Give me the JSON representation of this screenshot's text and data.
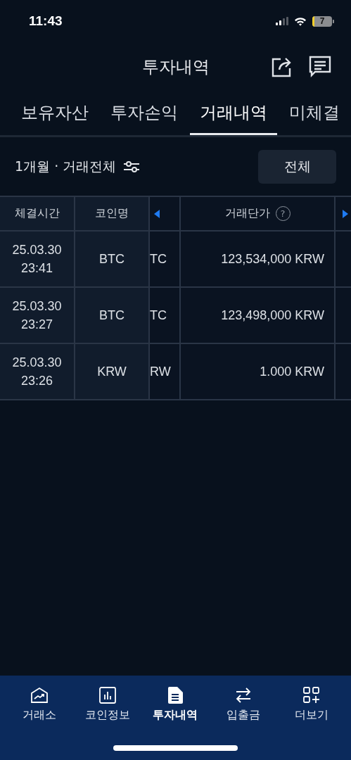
{
  "status_bar": {
    "time": "11:43",
    "battery": "7"
  },
  "header": {
    "title": "투자내역"
  },
  "tabs": [
    {
      "label": "보유자산",
      "selected": false
    },
    {
      "label": "투자손익",
      "selected": false
    },
    {
      "label": "거래내역",
      "selected": true
    },
    {
      "label": "미체결",
      "selected": false
    }
  ],
  "filter": {
    "label": "1개월 · 거래전체",
    "button": "전체"
  },
  "table": {
    "columns": [
      {
        "kind": "text",
        "label": "체결시간"
      },
      {
        "kind": "text",
        "label": "코인명"
      },
      {
        "kind": "scroll-left"
      },
      {
        "kind": "text",
        "label": "거래단가",
        "help": "?"
      },
      {
        "kind": "scroll-right"
      }
    ],
    "rows": [
      {
        "date": "25.03.30",
        "time": "23:41",
        "coin": "BTC",
        "column_3": "TC",
        "price": "123,534,000 KRW"
      },
      {
        "date": "25.03.30",
        "time": "23:27",
        "coin": "BTC",
        "column_3": "TC",
        "price": "123,498,000 KRW"
      },
      {
        "date": "25.03.30",
        "time": "23:26",
        "coin": "KRW",
        "column_3": "RW",
        "price": "1.000 KRW"
      }
    ]
  },
  "bottom_nav": [
    {
      "kind": "exchange",
      "label": "거래소",
      "selected": false
    },
    {
      "kind": "coin-info",
      "label": "코인정보",
      "selected": false
    },
    {
      "kind": "history",
      "label": "투자내역",
      "selected": true
    },
    {
      "kind": "transfer",
      "label": "입출금",
      "selected": false
    },
    {
      "kind": "more",
      "label": "더보기",
      "selected": false
    }
  ]
}
